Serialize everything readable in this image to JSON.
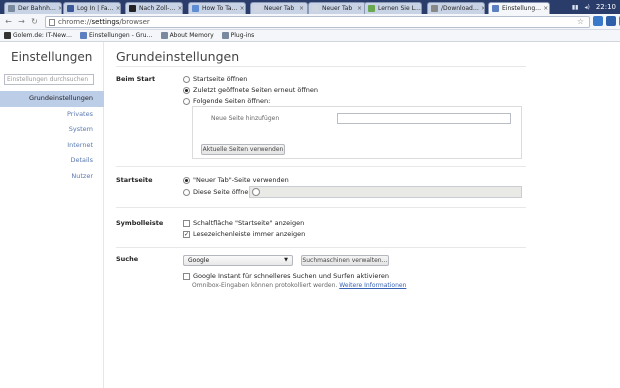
{
  "tabs": [
    {
      "label": "Der Bahnh…",
      "fav": "#7a8a9e"
    },
    {
      "label": "Log In | Fa…",
      "fav": "#3b5998"
    },
    {
      "label": "Nach Zoll-…",
      "fav": "#222222"
    },
    {
      "label": "How To Ta…",
      "fav": "#5f8dd3"
    },
    {
      "label": "Neuer Tab",
      "fav": "#cfd6e2"
    },
    {
      "label": "Neuer Tab",
      "fav": "#cfd6e2"
    },
    {
      "label": "Lernen Sie L…",
      "fav": "#6aa84f"
    },
    {
      "label": "/Download…",
      "fav": "#888888"
    },
    {
      "label": "Einstellung…",
      "fav": "#5b7fc0",
      "active": true
    }
  ],
  "window": {
    "clock": "22:10"
  },
  "omnibox": {
    "host": "chrome://",
    "bold": "settings",
    "path": "/browser"
  },
  "bookmarks": [
    {
      "label": "Golem.de: IT-New…",
      "color": "#333333"
    },
    {
      "label": "Einstellungen - Gru…",
      "color": "#5b7fc0"
    },
    {
      "label": "About Memory",
      "color": "#7a8a9e"
    },
    {
      "label": "Plug-ins",
      "color": "#7a8a9e"
    }
  ],
  "sidebar": {
    "title": "Einstellungen",
    "search_placeholder": "Einstellungen durchsuchen",
    "items": [
      "Grundeinstellungen",
      "Privates",
      "System",
      "Internet",
      "Details",
      "Nutzer"
    ]
  },
  "main": {
    "title": "Grundeinstellungen",
    "start": {
      "label": "Beim Start",
      "options": [
        "Startseite öffnen",
        "Zuletzt geöffnete Seiten erneut öffnen",
        "Folgende Seiten öffnen:"
      ],
      "selected": 1,
      "add_page_label": "Neue Seite hinzufügen",
      "use_current_button": "Aktuelle Seiten verwenden"
    },
    "homepage": {
      "label": "Startseite",
      "options": [
        "\"Neuer Tab\"-Seite verwenden",
        "Diese Seite öffnen:"
      ],
      "selected": 0
    },
    "toolbar": {
      "label": "Symbolleiste",
      "checks": [
        {
          "label": "Schaltfläche \"Startseite\" anzeigen",
          "checked": false
        },
        {
          "label": "Lesezeichenleiste immer anzeigen",
          "checked": true
        }
      ]
    },
    "search": {
      "label": "Suche",
      "engine": "Google",
      "manage_button": "Suchmaschinen verwalten…",
      "instant_label": "Google Instant für schnelleres Suchen und Surfen aktivieren",
      "instant_checked": false,
      "note": "Omnibox-Eingaben können protokolliert werden.",
      "link": "Weitere Informationen"
    }
  }
}
